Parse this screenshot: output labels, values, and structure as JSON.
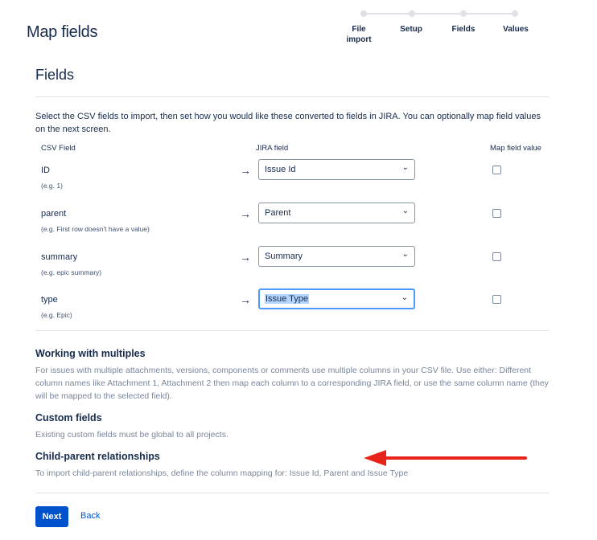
{
  "page": {
    "title": "Map fields"
  },
  "wizard": {
    "steps": [
      "File import",
      "Setup",
      "Fields",
      "Values"
    ]
  },
  "section": {
    "title": "Fields",
    "intro": "Select the CSV fields to import, then set how you would like these converted to fields in JIRA. You can optionally map field values on the next screen."
  },
  "table": {
    "headers": {
      "csv_field": "CSV Field",
      "jira_field": "JIRA field",
      "map_value": "Map field value"
    },
    "rows": [
      {
        "field": "ID",
        "example": "(e.g. 1)",
        "arrow": "→",
        "selected": "Issue Id",
        "map_checked": false
      },
      {
        "field": "parent",
        "example": "(e.g. First row doesn't have a value)",
        "arrow": "→",
        "selected": "Parent",
        "map_checked": false
      },
      {
        "field": "summary",
        "example": "(e.g. epic summary)",
        "arrow": "→",
        "selected": "Summary",
        "map_checked": false
      },
      {
        "field": "type",
        "example": "(e.g. Epic)",
        "arrow": "→",
        "selected": "Issue Type",
        "map_checked": false
      }
    ]
  },
  "help": {
    "multiples": {
      "title": "Working with multiples",
      "text": "For issues with multiple attachments, versions, components or comments use multiple columns in your CSV file. Use either: Different column names like Attachment 1, Attachment 2 then map each column to a corresponding JIRA field, or use the same column name (they will be mapped to the selected field)."
    },
    "custom": {
      "title": "Custom fields",
      "text": "Existing custom fields must be global to all projects."
    },
    "child_parent": {
      "title": "Child-parent relationships",
      "text": "To import child-parent relationships, define the column mapping for: Issue Id, Parent and Issue Type"
    }
  },
  "annotation": {
    "color": "#e8231a"
  },
  "actions": {
    "next": "Next",
    "back": "Back"
  },
  "colors": {
    "primary": "#0052cc",
    "focus": "#4c9aff",
    "text": "#172b4d",
    "muted": "#7a869a"
  }
}
